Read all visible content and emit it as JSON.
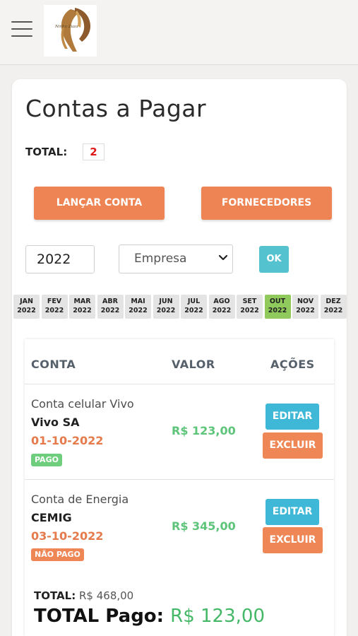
{
  "header": {
    "menu_icon": "hamburger-menu-icon",
    "logo_icon": "horse-logo-icon",
    "logo_text": "Ninho Zuza"
  },
  "page": {
    "title": "Contas a Pagar",
    "total_label": "TOTAL:",
    "total_count": "2"
  },
  "actions": {
    "lancar_label": "LANÇAR CONTA",
    "fornecedores_label": "FORNECEDORES"
  },
  "filters": {
    "year_value": "2022",
    "empresa_selected": "Empresa",
    "ok_label": "OK"
  },
  "months": [
    {
      "m": "JAN",
      "y": "2022",
      "active": false
    },
    {
      "m": "FEV",
      "y": "2022",
      "active": false
    },
    {
      "m": "MAR",
      "y": "2022",
      "active": false
    },
    {
      "m": "ABR",
      "y": "2022",
      "active": false
    },
    {
      "m": "MAI",
      "y": "2022",
      "active": false
    },
    {
      "m": "JUN",
      "y": "2022",
      "active": false
    },
    {
      "m": "JUL",
      "y": "2022",
      "active": false
    },
    {
      "m": "AGO",
      "y": "2022",
      "active": false
    },
    {
      "m": "SET",
      "y": "2022",
      "active": false
    },
    {
      "m": "OUT",
      "y": "2022",
      "active": true
    },
    {
      "m": "NOV",
      "y": "2022",
      "active": false
    },
    {
      "m": "DEZ",
      "y": "2022",
      "active": false
    }
  ],
  "table": {
    "headers": {
      "conta": "CONTA",
      "valor": "VALOR",
      "acoes": "AÇÕES"
    },
    "rows": [
      {
        "descricao": "Conta celular Vivo",
        "fornecedor": "Vivo SA",
        "data": "01-10-2022",
        "status": "PAGO",
        "valor": "R$ 123,00",
        "editar": "EDITAR",
        "excluir": "EXCLUIR"
      },
      {
        "descricao": "Conta de Energia",
        "fornecedor": "CEMIG",
        "data": "03-10-2022",
        "status": "NÃO PAGO",
        "valor": "R$ 345,00",
        "editar": "EDITAR",
        "excluir": "EXCLUIR"
      }
    ]
  },
  "summary": {
    "total_label": "TOTAL:",
    "total_value": "R$ 468,00",
    "pago_label": "TOTAL Pago:",
    "pago_value": "R$ 123,00"
  },
  "colors": {
    "accent_orange": "#ee8453",
    "ok_teal": "#54c2cf",
    "edit_blue": "#3fb8d8",
    "active_month_green": "#90c95c",
    "value_green": "#5dc47a",
    "date_orange": "#e57a4b"
  }
}
